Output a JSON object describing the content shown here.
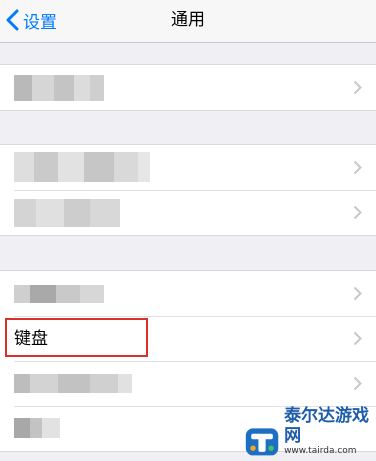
{
  "navbar": {
    "back_label": "设置",
    "title": "通用"
  },
  "rows": {
    "keyboard_label": "键盘"
  },
  "watermark": {
    "brand": "泰尔达游戏网",
    "url": "www.tairda.com"
  },
  "colors": {
    "accent": "#007aff",
    "highlight": "#d9302c",
    "background": "#efeff4"
  },
  "icons": [
    "chevron-left-icon",
    "chevron-right-icon",
    "tairda-logo-icon"
  ]
}
